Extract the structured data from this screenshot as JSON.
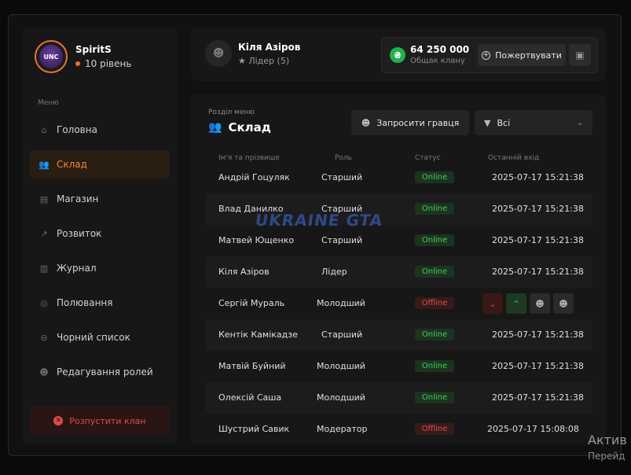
{
  "profile": {
    "name": "SpiritS",
    "level": "10 рівень",
    "avatar_text": "UNC"
  },
  "menu": {
    "label": "Меню",
    "items": [
      {
        "label": "Головна",
        "icon": "home-icon",
        "glyph": "⌂",
        "active": false
      },
      {
        "label": "Склад",
        "icon": "users-icon",
        "glyph": "👥",
        "active": true
      },
      {
        "label": "Магазин",
        "icon": "shop-icon",
        "glyph": "▤",
        "active": false
      },
      {
        "label": "Розвиток",
        "icon": "chart-icon",
        "glyph": "↗",
        "active": false
      },
      {
        "label": "Журнал",
        "icon": "book-icon",
        "glyph": "▥",
        "active": false
      },
      {
        "label": "Полювання",
        "icon": "target-icon",
        "glyph": "◎",
        "active": false
      },
      {
        "label": "Чорний список",
        "icon": "block-icon",
        "glyph": "⊖",
        "active": false
      },
      {
        "label": "Редагування ролей",
        "icon": "user-edit-icon",
        "glyph": "☻",
        "active": false
      }
    ],
    "disband_label": "Розпустити клан"
  },
  "leader": {
    "name": "Кіля Азіров",
    "role": "Лідер (5)"
  },
  "bank": {
    "amount": "64 250 000",
    "label": "Общак клану",
    "donate_label": "Пожертвувати"
  },
  "section": {
    "label": "Розділ меню",
    "title": "Склад"
  },
  "invite_label": "Запросити гравця",
  "filter_value": "Всі",
  "table": {
    "headers": {
      "name": "Ім'я та прізвище",
      "role": "Роль",
      "status": "Статус",
      "last": "Останній вхід"
    },
    "rows": [
      {
        "name": "Андрій Гоцуляк",
        "role": "Старший",
        "status": "Online",
        "last": "2025-07-17 15:21:38"
      },
      {
        "name": "Влад Данилко",
        "role": "Старший",
        "status": "Online",
        "last": "2025-07-17 15:21:38"
      },
      {
        "name": "Матвей Ющенко",
        "role": "Старший",
        "status": "Online",
        "last": "2025-07-17 15:21:38"
      },
      {
        "name": "Кіля Азіров",
        "role": "Лідер",
        "status": "Online",
        "last": "2025-07-17 15:21:38"
      },
      {
        "name": "Сергій Мураль",
        "role": "Молодший",
        "status": "Offline",
        "last": ""
      },
      {
        "name": "Кентік Камікадзе",
        "role": "Старший",
        "status": "Online",
        "last": "2025-07-17 15:21:38"
      },
      {
        "name": "Матвій Буйний",
        "role": "Молодший",
        "status": "Online",
        "last": "2025-07-17 15:21:38"
      },
      {
        "name": "Олексій Саша",
        "role": "Молодший",
        "status": "Online",
        "last": "2025-07-17 15:21:38"
      },
      {
        "name": "Шустрий Савик",
        "role": "Модератор",
        "status": "Offline",
        "last": "2025-07-17 15:08:08"
      }
    ]
  },
  "watermark": "UKRAINE GTA",
  "os_notice": {
    "line1": "Актив",
    "line2": "Перейд"
  },
  "colors": {
    "accent": "#f08a3c",
    "online": "#3ecf5a",
    "offline": "#e04a4a"
  }
}
